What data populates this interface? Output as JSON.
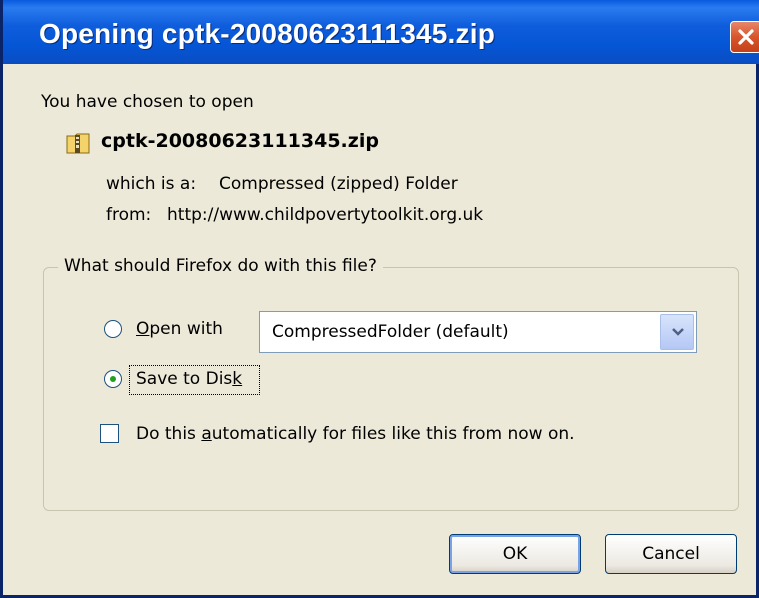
{
  "window": {
    "title": "Opening cptk-20080623111345.zip",
    "close_icon": "close-icon"
  },
  "intro": "You have chosen to open",
  "file": {
    "icon": "zip-folder-icon",
    "name": "cptk-20080623111345.zip",
    "which_is_label": "which is a:",
    "which_is_value": "Compressed (zipped) Folder",
    "from_label": "from:",
    "from_value": "http://www.childpovertytoolkit.org.uk"
  },
  "group": {
    "legend": "What should Firefox do with this file?",
    "open_with": {
      "pre": "",
      "key": "O",
      "post": "pen with",
      "selected": false
    },
    "open_with_app": "CompressedFolder (default)",
    "save_to_disk": {
      "pre": "Save to Dis",
      "key": "k",
      "post": "",
      "selected": true
    },
    "auto": {
      "pre": "Do this ",
      "key": "a",
      "post": "utomatically for files like this from now on.",
      "checked": false
    }
  },
  "buttons": {
    "ok": "OK",
    "cancel": "Cancel"
  },
  "colors": {
    "titlebar": "#0556d6",
    "dialog_bg": "#ece9d8",
    "close_button": "#d7562c",
    "radio_selected": "#21a121"
  }
}
